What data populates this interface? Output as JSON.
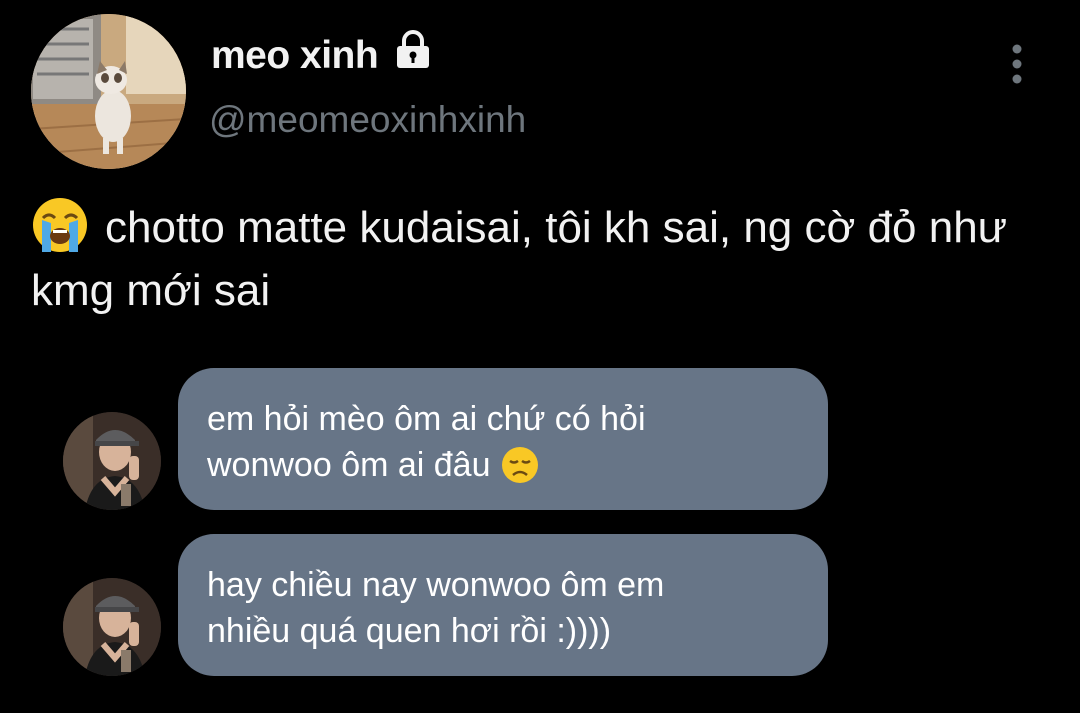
{
  "profile": {
    "display_name": "meo xinh",
    "handle": "@meomeoxinhxinh",
    "avatar_icon": "cat-photo-avatar",
    "protected_icon": "lock-icon"
  },
  "menu": {
    "icon": "more-vertical-icon"
  },
  "tweet": {
    "emoji": "loudly-crying-face-emoji",
    "text": "chotto matte kudaisai, tôi kh sai, ng cờ đỏ như kmg mới sai"
  },
  "messages": [
    {
      "avatar_icon": "person-cap-photo-avatar",
      "text": "em hỏi mèo ôm ai chứ có hỏi\nwonwoo ôm ai đâu",
      "emoji": "disappointed-face-emoji"
    },
    {
      "avatar_icon": "person-cap-photo-avatar",
      "text": "hay chiều nay wonwoo ôm em\nnhiều quá quen hơi rồi :))))",
      "emoji": ""
    }
  ],
  "colors": {
    "background": "#000000",
    "bubble": "#677587",
    "handle": "#6e767d",
    "text": "#f2f2f2"
  }
}
